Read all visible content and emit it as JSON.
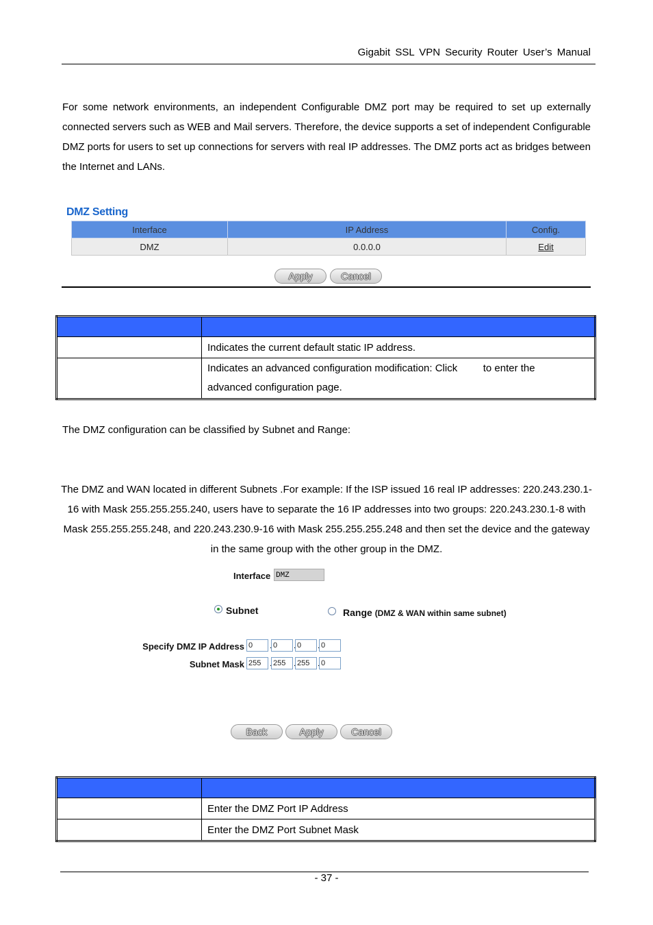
{
  "header": {
    "title": "Gigabit  SSL  VPN  Security  Router  User’s  Manual"
  },
  "intro": "For some network environments, an independent Configurable DMZ port may be required to set up externally connected servers such as WEB and Mail servers. Therefore, the device supports a set of independent Configurable DMZ ports for users to set up connections for servers with real IP addresses. The DMZ ports act as bridges between the Internet and LANs.",
  "dmz_setting": {
    "title": "DMZ Setting",
    "columns": [
      "Interface",
      "IP Address",
      "Config."
    ],
    "rows": [
      {
        "interface": "DMZ",
        "ip": "0.0.0.0",
        "config": "Edit"
      }
    ],
    "buttons": {
      "apply": "Apply",
      "cancel": "Cancel"
    }
  },
  "desc_table1": {
    "header": [
      "",
      ""
    ],
    "rows": [
      {
        "name": "",
        "desc": "Indicates the current default static IP address."
      },
      {
        "name": "",
        "desc_line1": "Indicates an advanced configuration modification: Click         to enter the",
        "desc_line2": "advanced configuration page."
      }
    ]
  },
  "classify_text": "The DMZ configuration can be classified by Subnet and Range:",
  "subnet_text": "The DMZ and WAN located in different Subnets .For example: If the ISP issued 16 real IP addresses: 220.243.230.1-16 with Mask 255.255.255.240, users have to separate the 16 IP addresses into two groups: 220.243.230.1-8 with Mask 255.255.255.248, and 220.243.230.9-16 with Mask 255.255.255.248 and then set the device and the gateway in the same group with the other group in the DMZ.",
  "edit_form": {
    "interface_label": "Interface",
    "interface_value": "DMZ",
    "mode_subnet": "Subnet",
    "mode_range": "Range",
    "mode_range_note": "(DMZ & WAN within same subnet)",
    "selected_mode": "Subnet",
    "ip_label": "Specify DMZ IP Address",
    "ip": [
      "0",
      "0",
      "0",
      "0"
    ],
    "mask_label": "Subnet Mask",
    "mask": [
      "255",
      "255",
      "255",
      "0"
    ],
    "buttons": {
      "back": "Back",
      "apply": "Apply",
      "cancel": "Cancel"
    }
  },
  "desc_table2": {
    "header": [
      "",
      ""
    ],
    "rows": [
      {
        "name": "",
        "desc": "Enter the DMZ Port IP Address"
      },
      {
        "name": "",
        "desc": "Enter the DMZ Port Subnet Mask"
      }
    ]
  },
  "footer": {
    "page": "- 37 -"
  }
}
